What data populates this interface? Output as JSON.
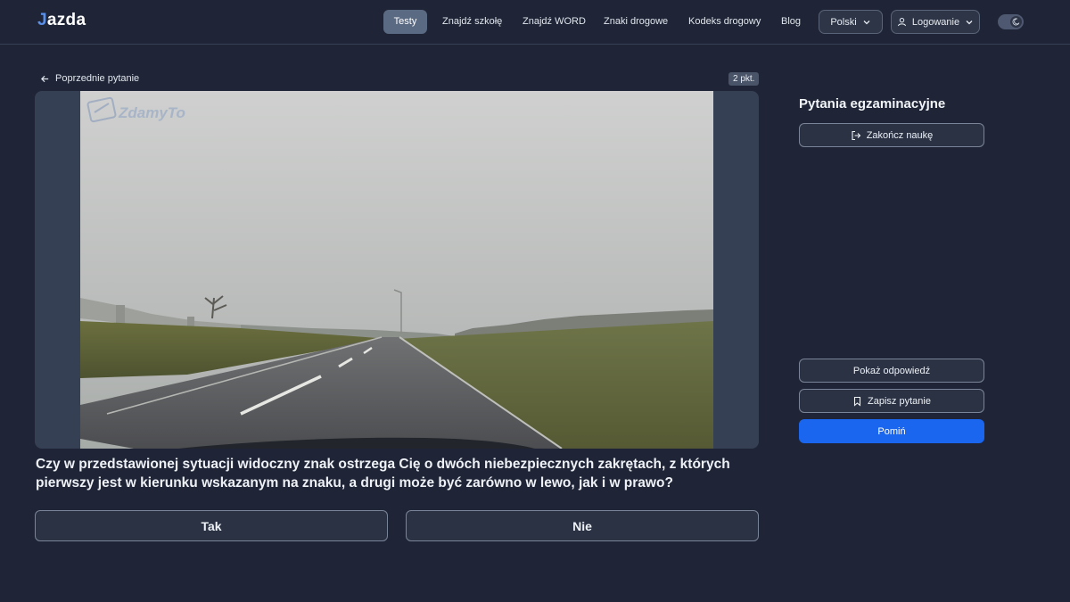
{
  "header": {
    "logo_j": "J",
    "logo_rest": "azda",
    "nav": [
      {
        "label": "Testy",
        "active": true
      },
      {
        "label": "Znajdź szkołę"
      },
      {
        "label": "Znajdź WORD"
      },
      {
        "label": "Znaki drogowe"
      },
      {
        "label": "Kodeks drogowy"
      },
      {
        "label": "Blog"
      }
    ],
    "language_label": "Polski",
    "login_label": "Logowanie",
    "theme_icon": "moon-icon"
  },
  "question_panel": {
    "back_label": "Poprzednie pytanie",
    "points_label": "2 pkt.",
    "watermark": "ZdamyTo",
    "question_text": "Czy w przedstawionej sytuacji widoczny znak ostrzega Cię o dwóch niebezpiecznych zakrętach, z których pierwszy jest w kierunku wskazanym na znaku, a drugi może być zarówno w lewo, jak i w prawo?",
    "answers": [
      "Tak",
      "Nie"
    ]
  },
  "sidebar": {
    "title": "Pytania egzaminacyjne",
    "end_learning_label": "Zakończ naukę",
    "show_answer_label": "Pokaż odpowiedź",
    "save_question_label": "Zapisz pytanie",
    "skip_label": "Pomiń"
  },
  "colors": {
    "background": "#1f2536",
    "accent": "#1a66ee",
    "panel": "#364055"
  }
}
